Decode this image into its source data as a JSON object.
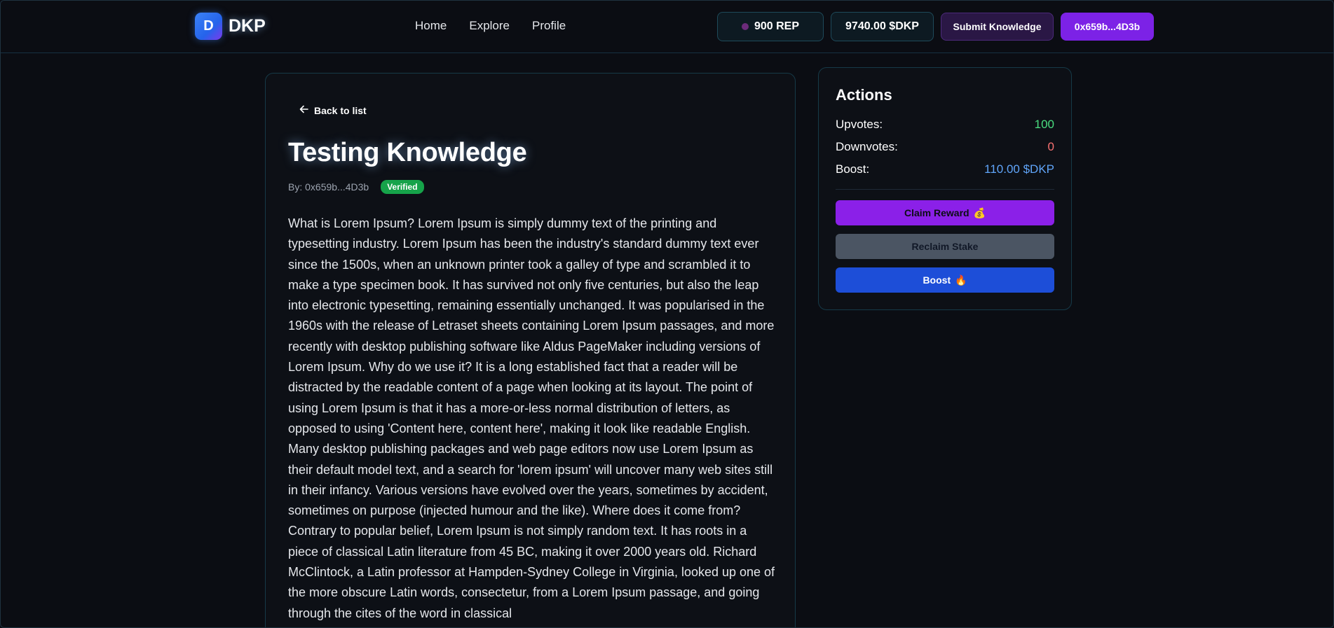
{
  "brand": {
    "logo_letter": "D",
    "name": "DKP"
  },
  "nav": {
    "links": [
      "Home",
      "Explore",
      "Profile"
    ]
  },
  "header": {
    "rep": "900 REP",
    "balance": "9740.00 $DKP",
    "submit_label": "Submit Knowledge",
    "wallet": "0x659b...4D3b"
  },
  "article": {
    "back_label": "Back to list",
    "title": "Testing Knowledge",
    "author": "By: 0x659b...4D3b",
    "status": "Verified",
    "body": "What is Lorem Ipsum? Lorem Ipsum is simply dummy text of the printing and typesetting industry. Lorem Ipsum has been the industry's standard dummy text ever since the 1500s, when an unknown printer took a galley of type and scrambled it to make a type specimen book. It has survived not only five centuries, but also the leap into electronic typesetting, remaining essentially unchanged. It was popularised in the 1960s with the release of Letraset sheets containing Lorem Ipsum passages, and more recently with desktop publishing software like Aldus PageMaker including versions of Lorem Ipsum. Why do we use it? It is a long established fact that a reader will be distracted by the readable content of a page when looking at its layout. The point of using Lorem Ipsum is that it has a more-or-less normal distribution of letters, as opposed to using 'Content here, content here', making it look like readable English. Many desktop publishing packages and web page editors now use Lorem Ipsum as their default model text, and a search for 'lorem ipsum' will uncover many web sites still in their infancy. Various versions have evolved over the years, sometimes by accident, sometimes on purpose (injected humour and the like). Where does it come from? Contrary to popular belief, Lorem Ipsum is not simply random text. It has roots in a piece of classical Latin literature from 45 BC, making it over 2000 years old. Richard McClintock, a Latin professor at Hampden-Sydney College in Virginia, looked up one of the more obscure Latin words, consectetur, from a Lorem Ipsum passage, and going through the cites of the word in classical"
  },
  "actions": {
    "title": "Actions",
    "upvotes_label": "Upvotes:",
    "upvotes": "100",
    "downvotes_label": "Downvotes:",
    "downvotes": "0",
    "boost_label": "Boost:",
    "boost": "110.00 $DKP",
    "claim_label": "Claim Reward",
    "claim_emoji": "💰",
    "reclaim_label": "Reclaim Stake",
    "boost_button_label": "Boost",
    "boost_emoji": "🔥"
  },
  "colors": {
    "background": "#0b0d13",
    "accent_purple": "#7c22e6",
    "boost_blue": "#1d4ed8",
    "verified_green": "#16a34a",
    "upvote_green": "#4ade80",
    "downvote_red": "#f87171",
    "boost_value_blue": "#60a5fa"
  }
}
